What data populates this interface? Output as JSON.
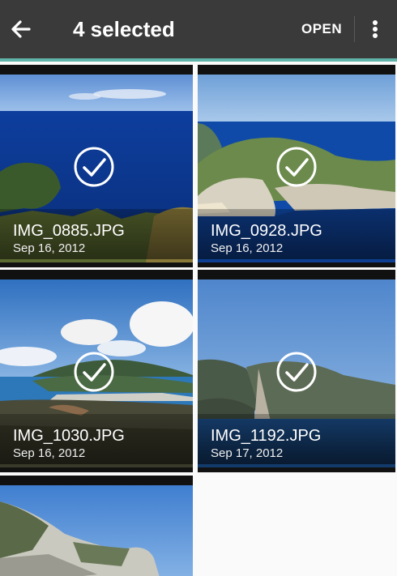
{
  "header": {
    "title": "4 selected",
    "open_label": "OPEN",
    "back_icon": "arrow-back-icon",
    "more_icon": "more-vert-icon",
    "background": "#3a3a3a",
    "accent": "#5fb3a8"
  },
  "photos": [
    {
      "name": "IMG_0885.JPG",
      "date": "Sep 16, 2012",
      "selected": true
    },
    {
      "name": "IMG_0928.JPG",
      "date": "Sep 16, 2012",
      "selected": true
    },
    {
      "name": "IMG_1030.JPG",
      "date": "Sep 16, 2012",
      "selected": true
    },
    {
      "name": "IMG_1192.JPG",
      "date": "Sep 17, 2012",
      "selected": true
    },
    {
      "name": "",
      "date": "",
      "selected": false
    }
  ]
}
